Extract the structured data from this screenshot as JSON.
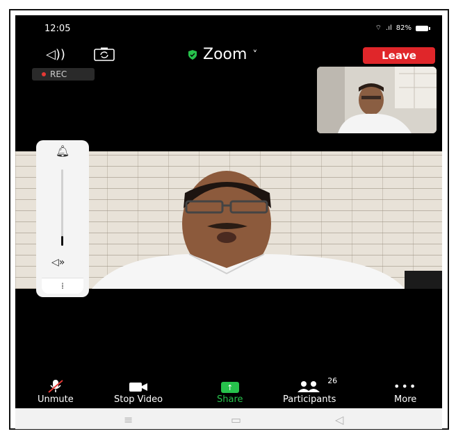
{
  "status_bar": {
    "time": "12:05",
    "battery": "82%"
  },
  "meeting": {
    "title": "Zoom",
    "leave_label": "Leave",
    "rec_label": "REC"
  },
  "toolbar": {
    "unmute_label": "Unmute",
    "stop_video_label": "Stop Video",
    "share_label": "Share",
    "participants_label": "Participants",
    "participants_count": "26",
    "more_label": "More"
  },
  "colors": {
    "leave": "#e0262a",
    "share": "#27c24c",
    "rec_dot": "#e53935"
  },
  "icons": [
    "speaker-icon",
    "camera-switch-icon",
    "shield-icon",
    "chevron-down-icon",
    "bell-icon",
    "volume-icon",
    "mic-muted-icon",
    "video-camera-icon",
    "share-arrow-icon",
    "participants-icon",
    "more-dots-icon",
    "menu-nav-icon",
    "home-nav-icon",
    "back-nav-icon"
  ],
  "volume_level": 0.15
}
